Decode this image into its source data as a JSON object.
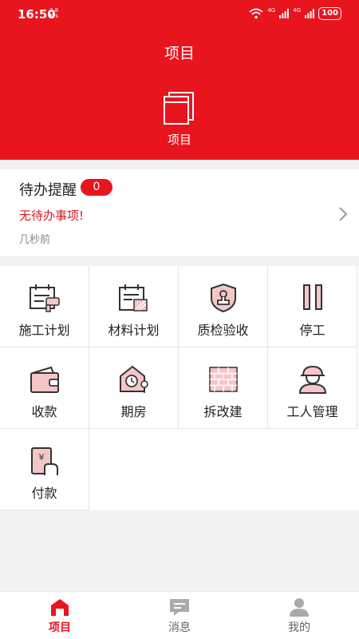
{
  "status_bar": {
    "time": "16:50",
    "speed_value": "3.8",
    "speed_unit": "K/s",
    "network_1": "4G",
    "network_2": "4G",
    "battery": "100"
  },
  "header": {
    "title": "项目",
    "project_label": "项目"
  },
  "todo": {
    "title": "待办提醒",
    "count": "0",
    "message": "无待办事项!",
    "time": "几秒前"
  },
  "grid": {
    "items": [
      {
        "label": "施工计划",
        "icon": "construction-plan-icon"
      },
      {
        "label": "材料计划",
        "icon": "material-plan-icon"
      },
      {
        "label": "质检验收",
        "icon": "quality-inspection-icon"
      },
      {
        "label": "停工",
        "icon": "pause-icon"
      },
      {
        "label": "收款",
        "icon": "wallet-icon"
      },
      {
        "label": "期房",
        "icon": "house-key-icon"
      },
      {
        "label": "拆改建",
        "icon": "brick-wall-icon"
      },
      {
        "label": "工人管理",
        "icon": "worker-icon"
      },
      {
        "label": "付款",
        "icon": "payment-icon"
      }
    ]
  },
  "tabbar": {
    "tabs": [
      {
        "label": "项目",
        "icon": "home-icon",
        "active": true
      },
      {
        "label": "消息",
        "icon": "message-icon",
        "active": false
      },
      {
        "label": "我的",
        "icon": "profile-icon",
        "active": false
      }
    ]
  },
  "colors": {
    "primary": "#e8141e",
    "icon_pink": "#f5c6c8",
    "background": "#f2f2f4"
  }
}
